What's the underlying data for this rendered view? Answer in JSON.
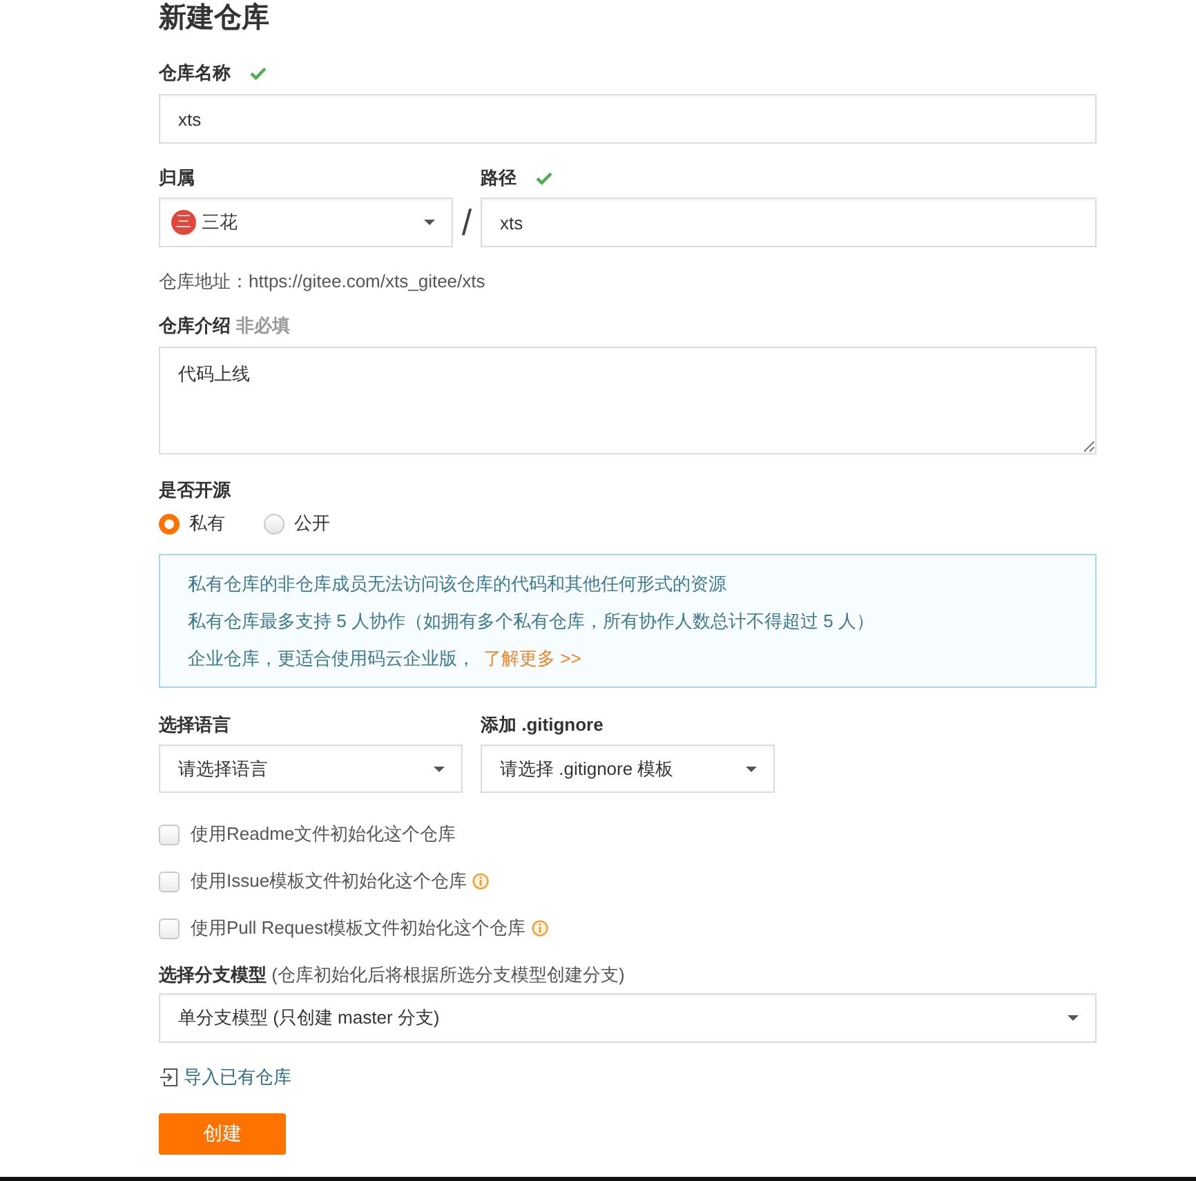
{
  "title": "新建仓库",
  "name_field": {
    "label": "仓库名称",
    "valid": true,
    "value": "xts"
  },
  "owner_field": {
    "label": "归属",
    "avatar_text": "三",
    "value": "三花"
  },
  "separator": "/",
  "path_field": {
    "label": "路径",
    "valid": true,
    "value": "xts"
  },
  "address": "仓库地址：https://gitee.com/xts_gitee/xts",
  "description_field": {
    "label": "仓库介绍",
    "hint": "非必填",
    "value": "代码上线"
  },
  "visibility": {
    "label": "是否开源",
    "options": [
      {
        "label": "私有",
        "selected": true
      },
      {
        "label": "公开",
        "selected": false
      }
    ]
  },
  "notice": {
    "lines": [
      "私有仓库的非仓库成员无法访问该仓库的代码和其他任何形式的资源",
      "私有仓库最多支持 5 人协作（如拥有多个私有仓库，所有协作人数总计不得超过 5 人）"
    ],
    "last_line": "企业仓库，更适合使用码云企业版，",
    "link": "了解更多 >>"
  },
  "language_field": {
    "label": "选择语言",
    "placeholder": "请选择语言"
  },
  "gitignore_field": {
    "label": "添加 .gitignore",
    "placeholder": "请选择 .gitignore 模板"
  },
  "options": [
    {
      "label": "使用Readme文件初始化这个仓库",
      "checked": false,
      "info": false
    },
    {
      "label": "使用Issue模板文件初始化这个仓库",
      "checked": false,
      "info": true
    },
    {
      "label": "使用Pull Request模板文件初始化这个仓库",
      "checked": false,
      "info": true
    }
  ],
  "branch_field": {
    "label": "**选择分支模型** (仓库初始化后将根据所选分支模型创建分支)",
    "value": "单分支模型 (只创建 master 分支)"
  },
  "import_link": "导入已有仓库",
  "submit_button": "创建"
}
